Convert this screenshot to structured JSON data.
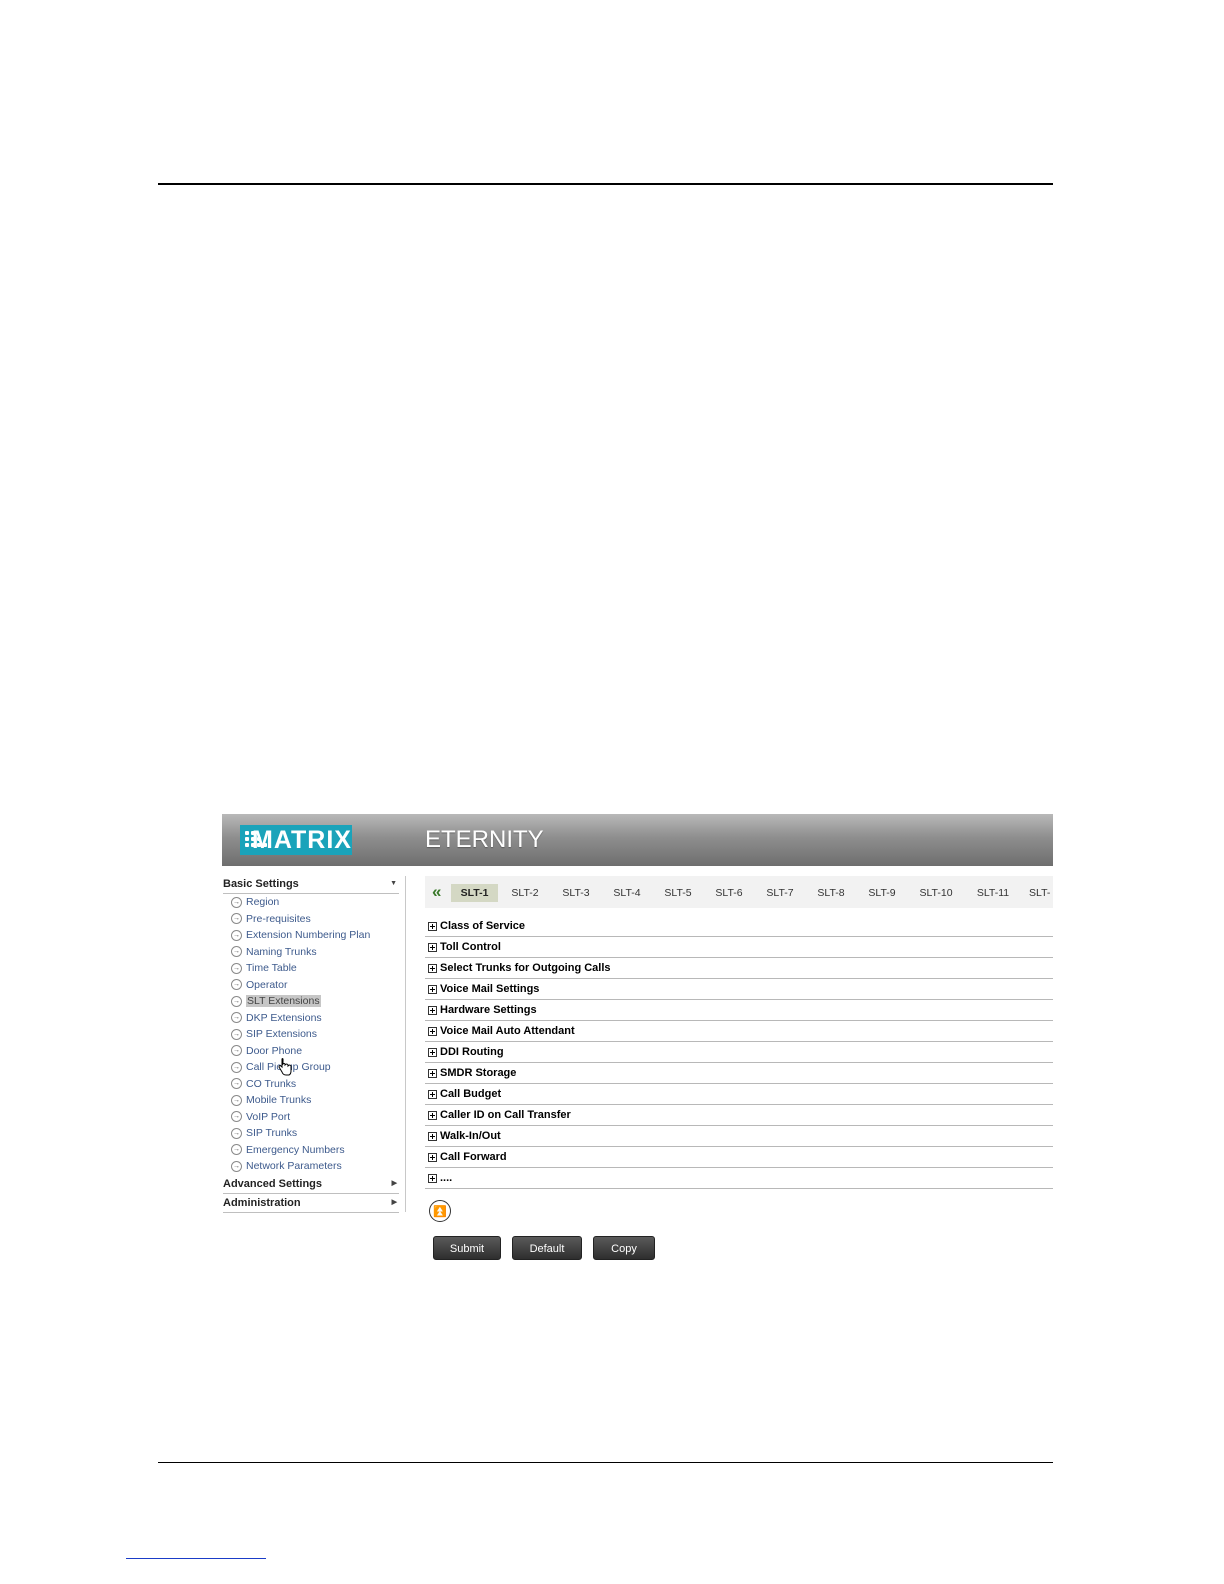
{
  "header": {
    "logo_text": "MATRIX",
    "product": "ETERNITY"
  },
  "sidebar": {
    "sections": [
      {
        "label": "Basic Settings",
        "arrow": "▼"
      },
      {
        "label": "Advanced Settings",
        "arrow": "▶"
      },
      {
        "label": "Administration",
        "arrow": "▶"
      }
    ],
    "items": [
      {
        "label": "Region"
      },
      {
        "label": "Pre-requisites"
      },
      {
        "label": "Extension Numbering Plan"
      },
      {
        "label": "Naming Trunks"
      },
      {
        "label": "Time Table"
      },
      {
        "label": "Operator"
      },
      {
        "label": "SLT Extensions"
      },
      {
        "label": "DKP Extensions"
      },
      {
        "label": "SIP Extensions"
      },
      {
        "label": "Door Phone"
      },
      {
        "label": "Call Pickup Group"
      },
      {
        "label": "CO Trunks"
      },
      {
        "label": "Mobile Trunks"
      },
      {
        "label": "VoIP Port"
      },
      {
        "label": "SIP Trunks"
      },
      {
        "label": "Emergency Numbers"
      },
      {
        "label": "Network Parameters"
      }
    ],
    "active_item": "SLT Extensions"
  },
  "tabs": {
    "back_icon": "«",
    "items": [
      "SLT-1",
      "SLT-2",
      "SLT-3",
      "SLT-4",
      "SLT-5",
      "SLT-6",
      "SLT-7",
      "SLT-8",
      "SLT-9",
      "SLT-10",
      "SLT-11",
      "SLT-"
    ],
    "active": "SLT-1"
  },
  "sections": [
    "Class of Service",
    "Toll Control",
    "Select Trunks for Outgoing Calls",
    "Voice Mail Settings",
    "Hardware Settings",
    "Voice Mail Auto Attendant",
    "DDI Routing",
    "SMDR Storage",
    "Call Budget",
    "Caller ID on Call Transfer",
    "Walk-In/Out",
    "Call Forward",
    "...."
  ],
  "scroll_top_icon": "⏫",
  "buttons": {
    "submit": "Submit",
    "default": "Default",
    "copy": "Copy"
  },
  "colors": {
    "accent": "#1aa3ba",
    "menu_link": "#3d5a8c",
    "tab_active": "#d4d8c4"
  }
}
